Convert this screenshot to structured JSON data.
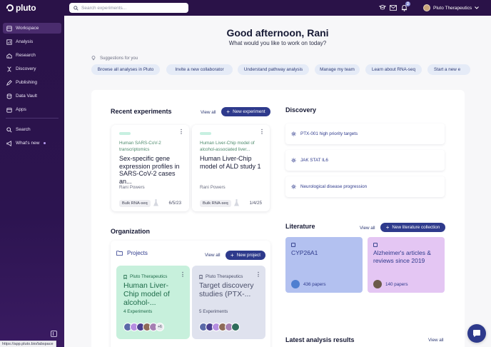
{
  "app": {
    "name": "pluto"
  },
  "search": {
    "placeholder": "Search experiments..."
  },
  "topbar": {
    "notification_count": "2",
    "org_name": "Pluto Therapeutics"
  },
  "sidebar": {
    "items": [
      {
        "label": "Workspace",
        "icon": "workspace-icon"
      },
      {
        "label": "Analysis",
        "icon": "chart-icon"
      },
      {
        "label": "Research",
        "icon": "research-icon"
      },
      {
        "label": "Discovery",
        "icon": "discovery-icon"
      },
      {
        "label": "Publishing",
        "icon": "publishing-icon"
      },
      {
        "label": "Data Vault",
        "icon": "database-icon"
      },
      {
        "label": "Apps",
        "icon": "apps-icon"
      },
      {
        "label": "Search",
        "icon": "search-icon"
      },
      {
        "label": "What's new",
        "icon": "megaphone-icon"
      }
    ]
  },
  "statusbar": {
    "url": "https://app.pluto.bio/labspace"
  },
  "greeting": {
    "title": "Good afternoon, Rani",
    "subtitle": "What would you like to work on today?"
  },
  "suggestions": {
    "label": "Suggestions for you",
    "chips": [
      "Browse all analyses in Pluto",
      "Invite a new collaborator",
      "Understand pathway analysis",
      "Manage my team",
      "Learn about RNA-seq",
      "Start a new e"
    ]
  },
  "recent_experiments": {
    "title": "Recent experiments",
    "view_all": "View all",
    "new_button": "New experiment",
    "cards": [
      {
        "category": "Human SARS-CoV-2 transcriptomics",
        "title": "Sex-specific gene expression profiles in SARS-CoV-2 cases an...",
        "owner": "Rani Powers",
        "tag": "Bulk RNA-seq",
        "date": "6/5/23"
      },
      {
        "category": "Human Liver-Chip model of alcohol-associated liver...",
        "title": "Human Liver-Chip model of ALD study 1",
        "owner": "Rani Powers",
        "tag": "Bulk RNA-seq",
        "date": "1/4/25"
      }
    ]
  },
  "discovery": {
    "title": "Discovery",
    "items": [
      "PTX-001 high priority targets",
      "JAK STAT IL6",
      "Neurological disease progression"
    ]
  },
  "literature": {
    "title": "Literature",
    "view_all": "View all",
    "new_button": "New literature collection",
    "cards": [
      {
        "title": "CYP26A1",
        "papers": "436 papers",
        "color": "#b3c1f0"
      },
      {
        "title": "Alzheimer's articles & reviews since 2019",
        "papers": "140 papers",
        "color": "#e4c6f3"
      }
    ]
  },
  "organization": {
    "title": "Organization",
    "projects_label": "Projects",
    "view_all": "View all",
    "new_button": "New project",
    "projects": [
      {
        "org": "Pluto Therapeutics",
        "title": "Human Liver-Chip model of alcohol-...",
        "count": "4 Experiments",
        "more": "+6",
        "bg": "#c7f0dc",
        "fg": "#1c6a48"
      },
      {
        "org": "Pluto Therapeutics",
        "title": "Target discovery studies (PTX-...",
        "count": "5 Experiments",
        "bg": "#dfe2ee",
        "fg": "#4a4f6a"
      }
    ]
  },
  "latest_analysis": {
    "title": "Latest analysis results",
    "view_all": "View all"
  },
  "colors": {
    "sidebar": "#2a1248",
    "accent": "#2e3a8c",
    "chip": "#e5ebf7"
  }
}
